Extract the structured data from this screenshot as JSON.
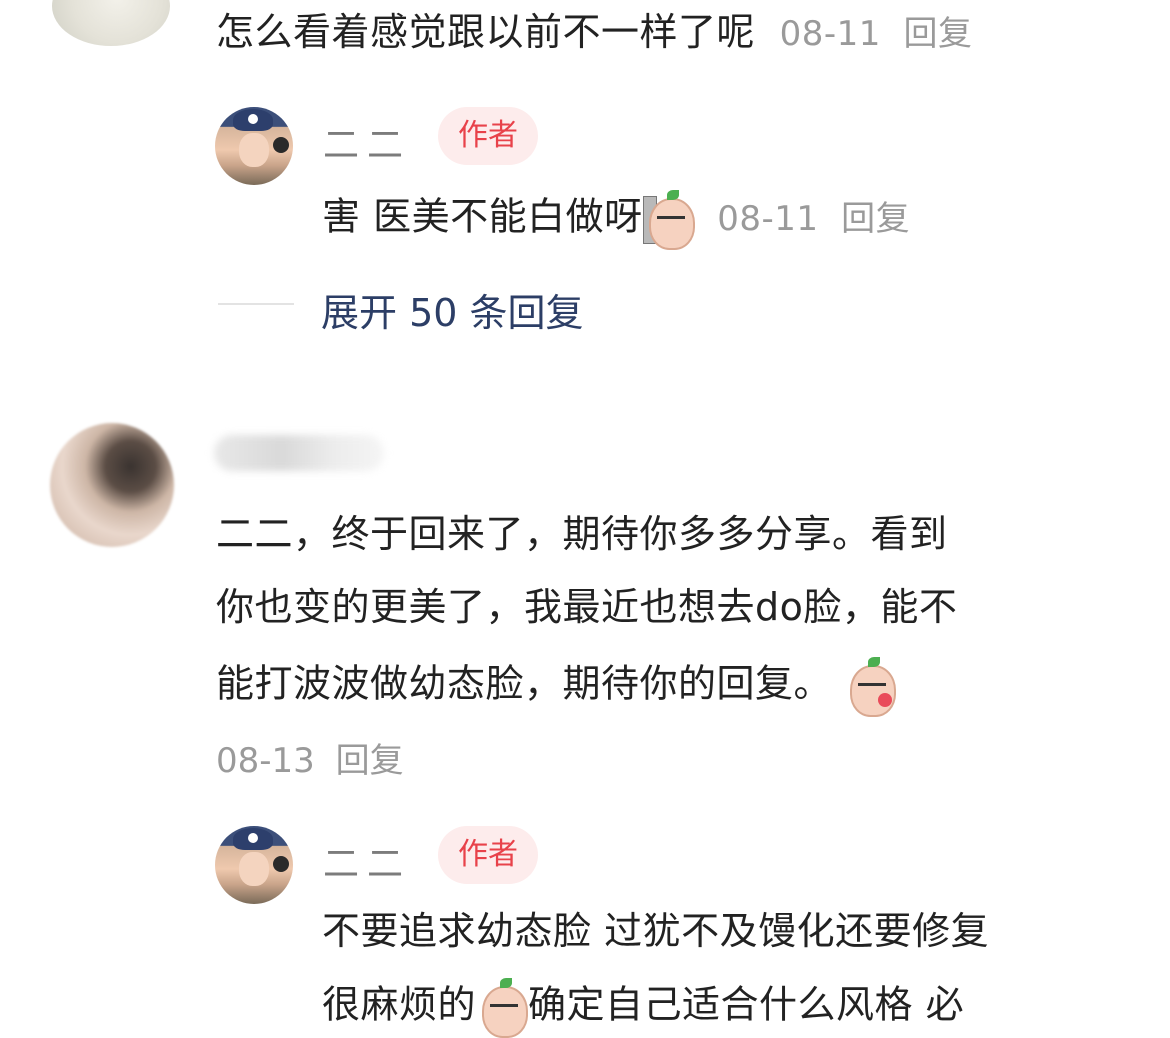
{
  "comment_top": {
    "text": "怎么看着感觉跟以前不一样了呢",
    "date": "08-11",
    "reply_label": "回复"
  },
  "reply_1": {
    "author": "二二",
    "badge": "作者",
    "text": "害 医美不能白做呀",
    "emoji": "reading-peach-sticker",
    "date": "08-11",
    "reply_label": "回复"
  },
  "expand": {
    "label": "展开 50 条回复"
  },
  "comment_2": {
    "line1": "二二，终于回来了，期待你多多分享。看到",
    "line2": "你也变的更美了，我最近也想去do脸，能不",
    "line3": "能打波波做幼态脸，期待你的回复。",
    "emoji": "kiss-peach-sticker",
    "date": "08-13",
    "reply_label": "回复"
  },
  "reply_2": {
    "author": "二二",
    "badge": "作者",
    "line1": "不要追求幼态脸 过犹不及馒化还要修复",
    "line2a": "很麻烦的",
    "emoji": "crying-peach-sticker",
    "line2b": "确定自己适合什么风格 必"
  }
}
